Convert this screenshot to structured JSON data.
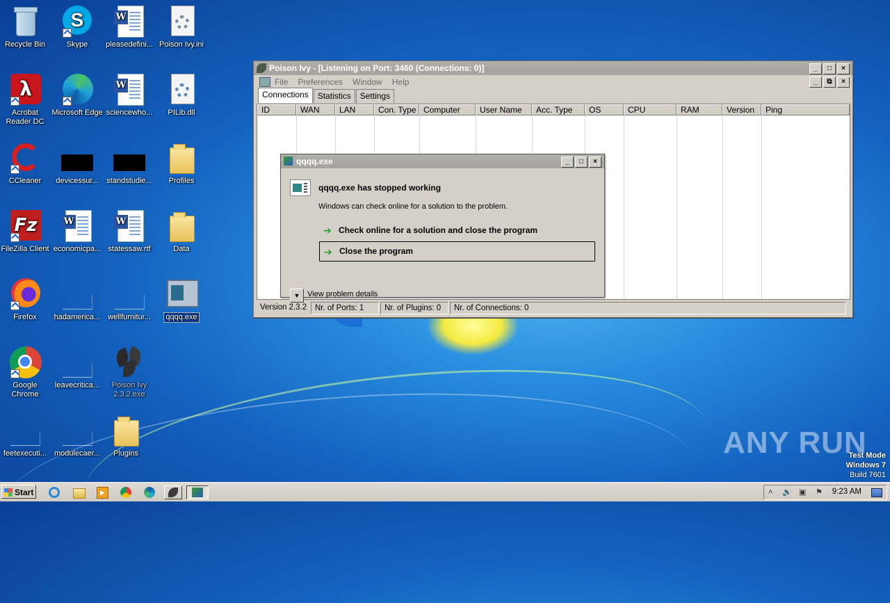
{
  "desktop": {
    "icons": [
      {
        "label": "Recycle Bin"
      },
      {
        "label": "Skype"
      },
      {
        "label": "pleasedefini..."
      },
      {
        "label": "Poison Ivy.ini"
      },
      {
        "label": "Acrobat Reader DC"
      },
      {
        "label": "Microsoft Edge"
      },
      {
        "label": "sciencewho..."
      },
      {
        "label": "PILib.dll"
      },
      {
        "label": "CCleaner"
      },
      {
        "label": "devicessur..."
      },
      {
        "label": "standstudie..."
      },
      {
        "label": "Profiles"
      },
      {
        "label": "FileZilla Client"
      },
      {
        "label": "economicpa..."
      },
      {
        "label": "statessaw.rtf"
      },
      {
        "label": "Data"
      },
      {
        "label": "Firefox"
      },
      {
        "label": "hadamerica..."
      },
      {
        "label": "wellfurnitur..."
      },
      {
        "label": "qqqq.exe"
      },
      {
        "label": "Google Chrome"
      },
      {
        "label": "leavecritica..."
      },
      {
        "label": "Poison Ivy 2.3.2.exe"
      },
      {
        "label": "feetexecuti..."
      },
      {
        "label": "modulecaer..."
      },
      {
        "label": "Plugins"
      }
    ]
  },
  "poison_ivy": {
    "title": "Poison Ivy - [Listening on Port: 3460 (Connections: 0)]",
    "menu": [
      "File",
      "Preferences",
      "Window",
      "Help"
    ],
    "tabs": [
      "Connections",
      "Statistics",
      "Settings"
    ],
    "active_tab": "Connections",
    "columns": [
      "ID",
      "WAN",
      "LAN",
      "Con. Type",
      "Computer",
      "User Name",
      "Acc. Type",
      "OS",
      "CPU",
      "RAM",
      "Version",
      "Ping"
    ],
    "status": {
      "version": "Version 2.3.2",
      "ports": "Nr. of Ports: 1",
      "plugins": "Nr. of Plugins: 0",
      "connections": "Nr. of Connections: 0"
    }
  },
  "error_dialog": {
    "title": "qqqq.exe",
    "heading": "qqqq.exe has stopped working",
    "subtext": "Windows can check online for a solution to the problem.",
    "option_check": "Check online for a solution and close the program",
    "option_close": "Close the program",
    "details": "View problem details"
  },
  "watermark": "ANY RUN",
  "test_mode": {
    "line1": "Test Mode",
    "line2": "Windows 7",
    "line3": "Build 7601"
  },
  "taskbar": {
    "start_label": "Start",
    "clock": "9:23 AM"
  },
  "icons": {
    "arrow": "green-arrow-icon",
    "colors": {
      "accent": "#1e9e2e",
      "title_inactive": "#a8a7a2",
      "selection": "#0a3a9a"
    }
  }
}
